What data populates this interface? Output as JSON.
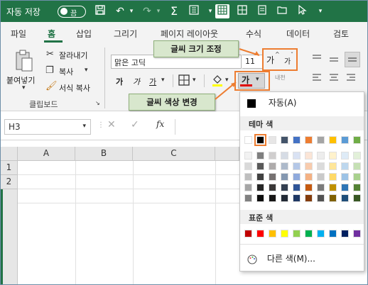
{
  "titlebar": {
    "autosave_label": "자동 저장",
    "autosave_state": "끔"
  },
  "tabs": [
    "파일",
    "홈",
    "삽입",
    "그리기",
    "페이지 레이아웃",
    "수식",
    "데이터",
    "검토"
  ],
  "ribbon": {
    "paste_label": "붙여넣기",
    "cut_label": "잘라내기",
    "copy_label": "복사",
    "format_painter_label": "서식 복사",
    "clipboard_group": "클립보드",
    "font_name": "맑은 고딕",
    "font_size": "11",
    "bold_glyph": "가",
    "italic_glyph": "가",
    "underline_glyph": "가",
    "grow_font_glyph": "가",
    "shrink_font_glyph": "가",
    "font_color_glyph": "가",
    "font_color_hex": "#e00000",
    "phonetic_glyph": "내천"
  },
  "callouts": {
    "font_size_change": "글씨 크기 조정",
    "font_color_change": "글씨 색상 변경"
  },
  "formula_bar": {
    "name_box": "H3",
    "fx": "fx"
  },
  "grid": {
    "columns": [
      "A",
      "B",
      "C"
    ],
    "rows": [
      "1",
      "2"
    ]
  },
  "font_color_menu": {
    "automatic_label": "자동(A)",
    "theme_colors_label": "테마 색",
    "standard_colors_label": "표준 색",
    "more_colors_label": "다른 색(M)...",
    "theme_top_row": [
      "#ffffff",
      "#000000",
      "#e7e6e6",
      "#44546a",
      "#4472c4",
      "#ed7d31",
      "#a5a5a5",
      "#ffc000",
      "#5b9bd5",
      "#70ad47"
    ],
    "theme_shades": [
      [
        "#f2f2f2",
        "#7f7f7f",
        "#d0cece",
        "#d6dce5",
        "#d9e2f3",
        "#fbe5d6",
        "#ededed",
        "#fff2cc",
        "#deebf7",
        "#e2f0d9"
      ],
      [
        "#d9d9d9",
        "#595959",
        "#aeabab",
        "#adb9ca",
        "#b4c7e7",
        "#f8cbad",
        "#dbdbdb",
        "#ffe699",
        "#bdd7ee",
        "#c5e0b4"
      ],
      [
        "#bfbfbf",
        "#404040",
        "#767171",
        "#8497b0",
        "#8faadc",
        "#f4b183",
        "#c9c9c9",
        "#ffd966",
        "#9dc3e6",
        "#a9d18e"
      ],
      [
        "#a6a6a6",
        "#262626",
        "#3b3838",
        "#333f50",
        "#2f5597",
        "#c55a11",
        "#7b7b7b",
        "#bf9000",
        "#2e75b6",
        "#548235"
      ],
      [
        "#808080",
        "#0d0d0d",
        "#171616",
        "#222a35",
        "#1f3864",
        "#843c0c",
        "#525252",
        "#7f6000",
        "#1f4e79",
        "#385723"
      ]
    ],
    "standard": [
      "#c00000",
      "#ff0000",
      "#ffc000",
      "#ffff00",
      "#92d050",
      "#00b050",
      "#00b0f0",
      "#0070c0",
      "#002060",
      "#7030a0"
    ]
  }
}
